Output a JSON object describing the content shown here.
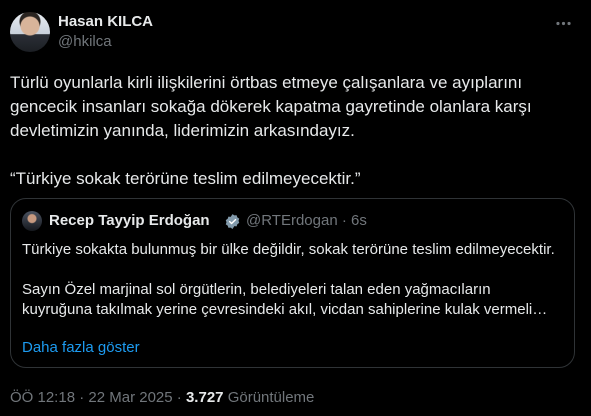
{
  "author": {
    "name": "Hasan KILCA",
    "handle": "@hkilca"
  },
  "tweet": {
    "text": "Türlü oyunlarla kirli ilişkilerini örtbas etmeye çalışanlara ve ayıplarını gencecik insanları sokağa dökerek kapatma gayretinde olanlara karşı devletimizin yanında, liderimizin arkasındayız.\n\n“Türkiye sokak terörüne teslim edilmeyecektir.”",
    "time": "ÖÖ 12:18",
    "separator": "·",
    "date": "22 Mar 2025",
    "views_count": "3.727",
    "views_label": "Görüntüleme"
  },
  "quote": {
    "name": "Recep Tayyip Erdoğan",
    "meta": "@RTErdogan · 6s",
    "text": "Türkiye sokakta bulunmuş bir ülke değildir, sokak terörüne teslim edilmeyecektir.\n\nSayın Özel marjinal sol örgütlerin, belediyeleri talan eden yağmacıların kuyruğuna takılmak yerine çevresindeki akıl, vicdan sahiplerine kulak vermeli…",
    "show_more": "Daha fazla göster"
  },
  "icons": {
    "more": "more-horizontal-icon",
    "verified": "verified-badge-icon"
  },
  "colors": {
    "background": "#000000",
    "text": "#e7e9ea",
    "secondary_text": "#71767b",
    "link": "#1d9bf0",
    "border": "#2f3336",
    "verified_badge": "#829aab"
  }
}
